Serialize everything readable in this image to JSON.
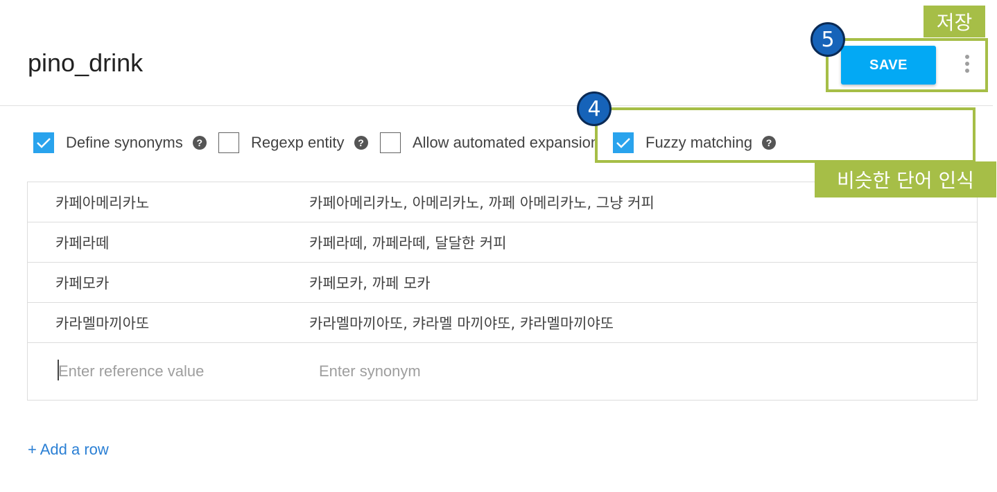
{
  "header": {
    "title": "pino_drink",
    "save_label": "SAVE"
  },
  "annotations": {
    "save_badge": "5",
    "save_caption": "저장",
    "fuzzy_badge": "4",
    "fuzzy_caption": "비슷한 단어 인식",
    "highlight_color": "#a6be47",
    "badge_color": "#1663b9"
  },
  "options": [
    {
      "label": "Define synonyms",
      "checked": true,
      "help": "?"
    },
    {
      "label": "Regexp entity",
      "checked": false,
      "help": "?"
    },
    {
      "label": "Allow automated expansion",
      "checked": false
    },
    {
      "label": "Fuzzy matching",
      "checked": true,
      "help": "?"
    }
  ],
  "entries": [
    {
      "reference": "카페아메리카노",
      "synonyms": "카페아메리카노, 아메리카노, 까페 아메리카노, 그냥 커피"
    },
    {
      "reference": "카페라떼",
      "synonyms": "카페라떼, 까페라떼, 달달한 커피"
    },
    {
      "reference": "카페모카",
      "synonyms": "카페모카, 까페 모카"
    },
    {
      "reference": "카라멜마끼아또",
      "synonyms": "카라멜마끼아또, 캬라멜 마끼야또, 캬라멜마끼야또"
    }
  ],
  "new_entry": {
    "reference_placeholder": "Enter reference value",
    "synonym_placeholder": "Enter synonym"
  },
  "add_row_label": "+ Add a row",
  "colors": {
    "primary": "#03a9f4",
    "checkbox": "#29a3ed",
    "link": "#2a7fd4"
  }
}
